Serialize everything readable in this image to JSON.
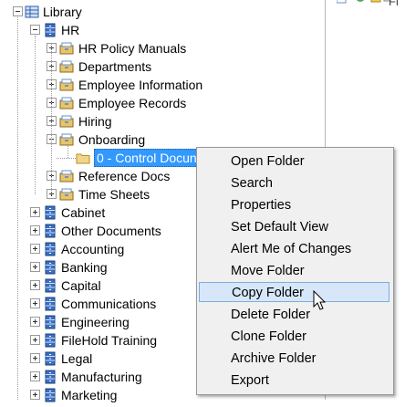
{
  "toolbar_right": {
    "text": "Fi"
  },
  "tree": {
    "root": "Library",
    "hr": "HR",
    "hr_children": [
      "HR Policy Manuals",
      "Departments",
      "Employee Information",
      "Employee Records",
      "Hiring",
      "Onboarding"
    ],
    "selected_folder": "0 - Control Docun",
    "hr_children_after": [
      "Reference Docs",
      "Time Sheets"
    ],
    "cabinets": [
      "Cabinet",
      "Other Documents",
      "Accounting",
      "Banking",
      "Capital",
      "Communications",
      "Engineering",
      "FileHold Training",
      "Legal",
      "Manufacturing",
      "Marketing"
    ]
  },
  "context_menu": {
    "items": [
      "Open Folder",
      "Search",
      "Properties",
      "Set Default View",
      "Alert Me of Changes",
      "Move Folder",
      "Copy Folder",
      "Delete Folder",
      "Clone Folder",
      "Archive Folder",
      "Export"
    ],
    "highlighted": "Copy Folder"
  },
  "colors": {
    "selection": "#3399ff",
    "menu_bg": "#f0f0f0",
    "menu_highlight": "#d7e7f9",
    "cabinet_icon": "#3a6fc4",
    "folder_icon": "#e8c56a"
  }
}
